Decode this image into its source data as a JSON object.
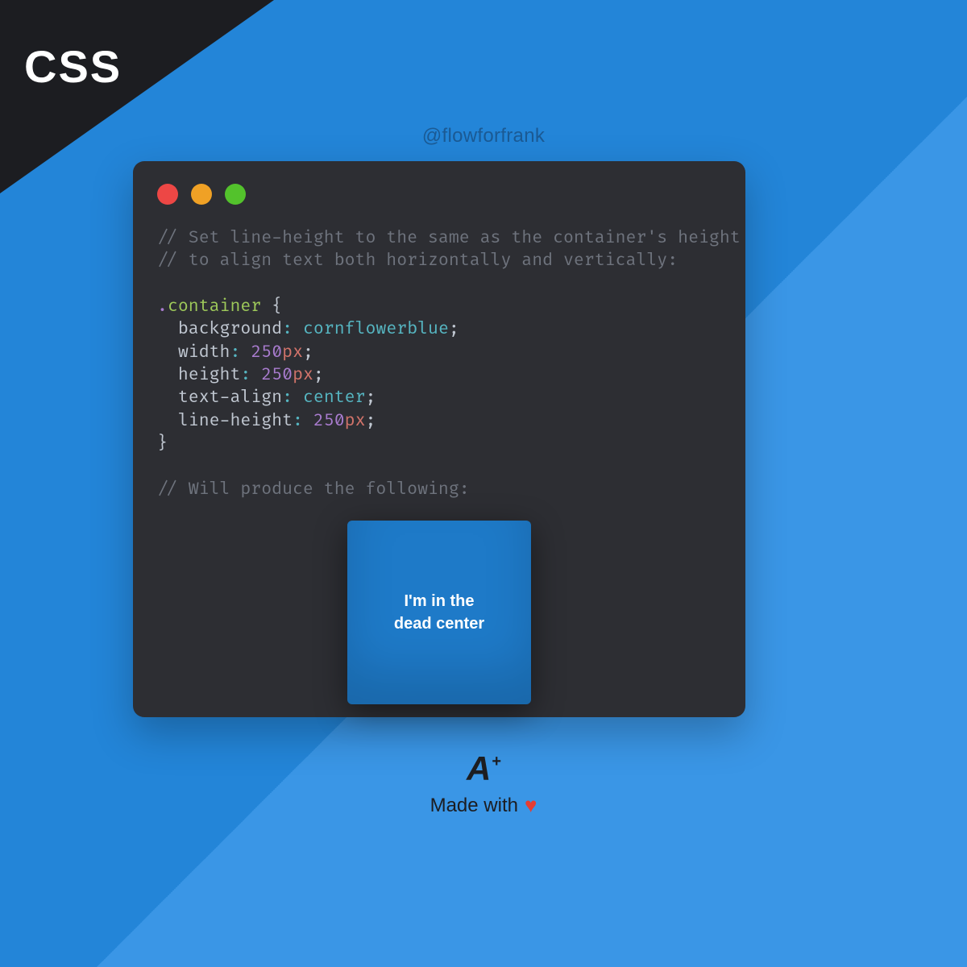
{
  "badge": {
    "label": "CSS"
  },
  "handle": "@flowforfrank",
  "code": {
    "comment_line1": "// Set line-height to the same as the container's height",
    "comment_line2": "// to align text both horizontally and vertically:",
    "selector_dot": ".",
    "selector": "container",
    "open_brace": " {",
    "props": [
      {
        "name": "background",
        "colon": ":",
        "value_ident": "cornflowerblue",
        "num": "",
        "unit": "",
        "semi": ";"
      },
      {
        "name": "width",
        "colon": ":",
        "value_ident": "",
        "num": "250",
        "unit": "px",
        "semi": ";"
      },
      {
        "name": "height",
        "colon": ":",
        "value_ident": "",
        "num": "250",
        "unit": "px",
        "semi": ";"
      },
      {
        "name": "text-align",
        "colon": ":",
        "value_ident": "center",
        "num": "",
        "unit": "",
        "semi": ";"
      },
      {
        "name": "line-height",
        "colon": ":",
        "value_ident": "",
        "num": "250",
        "unit": "px",
        "semi": ";"
      }
    ],
    "close_brace": "}",
    "comment_line3": "// Will produce the following:"
  },
  "demo": {
    "line1": "I'm in the",
    "line2": "dead center"
  },
  "footer": {
    "logo_letter": "A",
    "logo_plus": "+",
    "made_text": "Made with",
    "heart": "♥"
  }
}
